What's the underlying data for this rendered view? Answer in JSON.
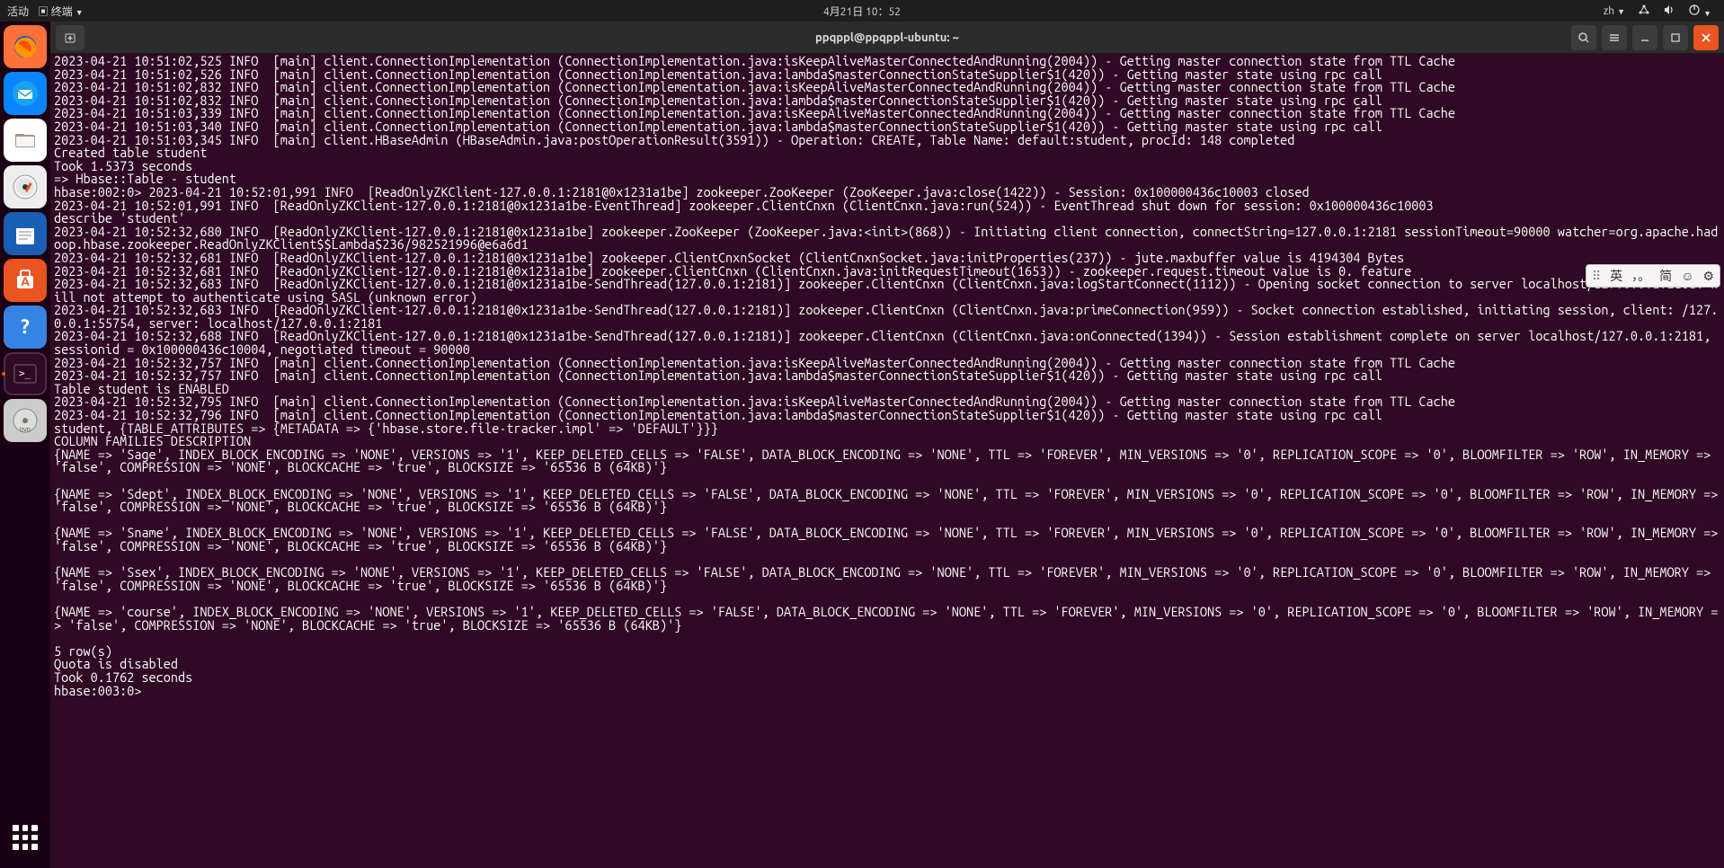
{
  "topbar": {
    "activities": "活动",
    "appname": "终端",
    "datetime": "4月21日 10：52",
    "lang": "zh"
  },
  "window": {
    "title": "ppqppl@ppqppl-ubuntu: ~"
  },
  "ime": {
    "mode": "英",
    "punct": "，。",
    "full": "简",
    "emoji": "☺",
    "gear": "⚙"
  },
  "terminal": {
    "lines": [
      "2023-04-21 10:51:02,525 INFO  [main] client.ConnectionImplementation (ConnectionImplementation.java:isKeepAliveMasterConnectedAndRunning(2004)) - Getting master connection state from TTL Cache",
      "2023-04-21 10:51:02,526 INFO  [main] client.ConnectionImplementation (ConnectionImplementation.java:lambda$masterConnectionStateSupplier$1(420)) - Getting master state using rpc call",
      "2023-04-21 10:51:02,832 INFO  [main] client.ConnectionImplementation (ConnectionImplementation.java:isKeepAliveMasterConnectedAndRunning(2004)) - Getting master connection state from TTL Cache",
      "2023-04-21 10:51:02,832 INFO  [main] client.ConnectionImplementation (ConnectionImplementation.java:lambda$masterConnectionStateSupplier$1(420)) - Getting master state using rpc call",
      "2023-04-21 10:51:03,339 INFO  [main] client.ConnectionImplementation (ConnectionImplementation.java:isKeepAliveMasterConnectedAndRunning(2004)) - Getting master connection state from TTL Cache",
      "2023-04-21 10:51:03,340 INFO  [main] client.ConnectionImplementation (ConnectionImplementation.java:lambda$masterConnectionStateSupplier$1(420)) - Getting master state using rpc call",
      "2023-04-21 10:51:03,345 INFO  [main] client.HBaseAdmin (HBaseAdmin.java:postOperationResult(3591)) - Operation: CREATE, Table Name: default:student, procId: 148 completed",
      "Created table student",
      "Took 1.5373 seconds",
      "=> Hbase::Table - student",
      "hbase:002:0> 2023-04-21 10:52:01,991 INFO  [ReadOnlyZKClient-127.0.0.1:2181@0x1231a1be] zookeeper.ZooKeeper (ZooKeeper.java:close(1422)) - Session: 0x100000436c10003 closed",
      "2023-04-21 10:52:01,991 INFO  [ReadOnlyZKClient-127.0.0.1:2181@0x1231a1be-EventThread] zookeeper.ClientCnxn (ClientCnxn.java:run(524)) - EventThread shut down for session: 0x100000436c10003",
      "describe 'student'",
      "2023-04-21 10:52:32,680 INFO  [ReadOnlyZKClient-127.0.0.1:2181@0x1231a1be] zookeeper.ZooKeeper (ZooKeeper.java:<init>(868)) - Initiating client connection, connectString=127.0.0.1:2181 sessionTimeout=90000 watcher=org.apache.hadoop.hbase.zookeeper.ReadOnlyZKClient$$Lambda$236/982521996@e6a6d1",
      "2023-04-21 10:52:32,681 INFO  [ReadOnlyZKClient-127.0.0.1:2181@0x1231a1be] zookeeper.ClientCnxnSocket (ClientCnxnSocket.java:initProperties(237)) - jute.maxbuffer value is 4194304 Bytes",
      "2023-04-21 10:52:32,681 INFO  [ReadOnlyZKClient-127.0.0.1:2181@0x1231a1be] zookeeper.ClientCnxn (ClientCnxn.java:initRequestTimeout(1653)) - zookeeper.request.timeout value is 0. feature ",
      "2023-04-21 10:52:32,683 INFO  [ReadOnlyZKClient-127.0.0.1:2181@0x1231a1be-SendThread(127.0.0.1:2181)] zookeeper.ClientCnxn (ClientCnxn.java:logStartConnect(1112)) - Opening socket connection to server localhost/127.0.0.1:2181. Will not attempt to authenticate using SASL (unknown error)",
      "2023-04-21 10:52:32,683 INFO  [ReadOnlyZKClient-127.0.0.1:2181@0x1231a1be-SendThread(127.0.0.1:2181)] zookeeper.ClientCnxn (ClientCnxn.java:primeConnection(959)) - Socket connection established, initiating session, client: /127.0.0.1:55754, server: localhost/127.0.0.1:2181",
      "2023-04-21 10:52:32,688 INFO  [ReadOnlyZKClient-127.0.0.1:2181@0x1231a1be-SendThread(127.0.0.1:2181)] zookeeper.ClientCnxn (ClientCnxn.java:onConnected(1394)) - Session establishment complete on server localhost/127.0.0.1:2181, sessionid = 0x100000436c10004, negotiated timeout = 90000",
      "2023-04-21 10:52:32,757 INFO  [main] client.ConnectionImplementation (ConnectionImplementation.java:isKeepAliveMasterConnectedAndRunning(2004)) - Getting master connection state from TTL Cache",
      "2023-04-21 10:52:32,757 INFO  [main] client.ConnectionImplementation (ConnectionImplementation.java:lambda$masterConnectionStateSupplier$1(420)) - Getting master state using rpc call",
      "Table student is ENABLED",
      "2023-04-21 10:52:32,795 INFO  [main] client.ConnectionImplementation (ConnectionImplementation.java:isKeepAliveMasterConnectedAndRunning(2004)) - Getting master connection state from TTL Cache",
      "2023-04-21 10:52:32,796 INFO  [main] client.ConnectionImplementation (ConnectionImplementation.java:lambda$masterConnectionStateSupplier$1(420)) - Getting master state using rpc call",
      "student, {TABLE_ATTRIBUTES => {METADATA => {'hbase.store.file-tracker.impl' => 'DEFAULT'}}}",
      "COLUMN FAMILIES DESCRIPTION",
      "{NAME => 'Sage', INDEX_BLOCK_ENCODING => 'NONE', VERSIONS => '1', KEEP_DELETED_CELLS => 'FALSE', DATA_BLOCK_ENCODING => 'NONE', TTL => 'FOREVER', MIN_VERSIONS => '0', REPLICATION_SCOPE => '0', BLOOMFILTER => 'ROW', IN_MEMORY => 'false', COMPRESSION => 'NONE', BLOCKCACHE => 'true', BLOCKSIZE => '65536 B (64KB)'}",
      "",
      "{NAME => 'Sdept', INDEX_BLOCK_ENCODING => 'NONE', VERSIONS => '1', KEEP_DELETED_CELLS => 'FALSE', DATA_BLOCK_ENCODING => 'NONE', TTL => 'FOREVER', MIN_VERSIONS => '0', REPLICATION_SCOPE => '0', BLOOMFILTER => 'ROW', IN_MEMORY => 'false', COMPRESSION => 'NONE', BLOCKCACHE => 'true', BLOCKSIZE => '65536 B (64KB)'}",
      "",
      "{NAME => 'Sname', INDEX_BLOCK_ENCODING => 'NONE', VERSIONS => '1', KEEP_DELETED_CELLS => 'FALSE', DATA_BLOCK_ENCODING => 'NONE', TTL => 'FOREVER', MIN_VERSIONS => '0', REPLICATION_SCOPE => '0', BLOOMFILTER => 'ROW', IN_MEMORY => 'false', COMPRESSION => 'NONE', BLOCKCACHE => 'true', BLOCKSIZE => '65536 B (64KB)'}",
      "",
      "{NAME => 'Ssex', INDEX_BLOCK_ENCODING => 'NONE', VERSIONS => '1', KEEP_DELETED_CELLS => 'FALSE', DATA_BLOCK_ENCODING => 'NONE', TTL => 'FOREVER', MIN_VERSIONS => '0', REPLICATION_SCOPE => '0', BLOOMFILTER => 'ROW', IN_MEMORY => 'false', COMPRESSION => 'NONE', BLOCKCACHE => 'true', BLOCKSIZE => '65536 B (64KB)'}",
      "",
      "{NAME => 'course', INDEX_BLOCK_ENCODING => 'NONE', VERSIONS => '1', KEEP_DELETED_CELLS => 'FALSE', DATA_BLOCK_ENCODING => 'NONE', TTL => 'FOREVER', MIN_VERSIONS => '0', REPLICATION_SCOPE => '0', BLOOMFILTER => 'ROW', IN_MEMORY => 'false', COMPRESSION => 'NONE', BLOCKCACHE => 'true', BLOCKSIZE => '65536 B (64KB)'}",
      "",
      "5 row(s)",
      "Quota is disabled",
      "Took 0.1762 seconds",
      "hbase:003:0> "
    ]
  }
}
